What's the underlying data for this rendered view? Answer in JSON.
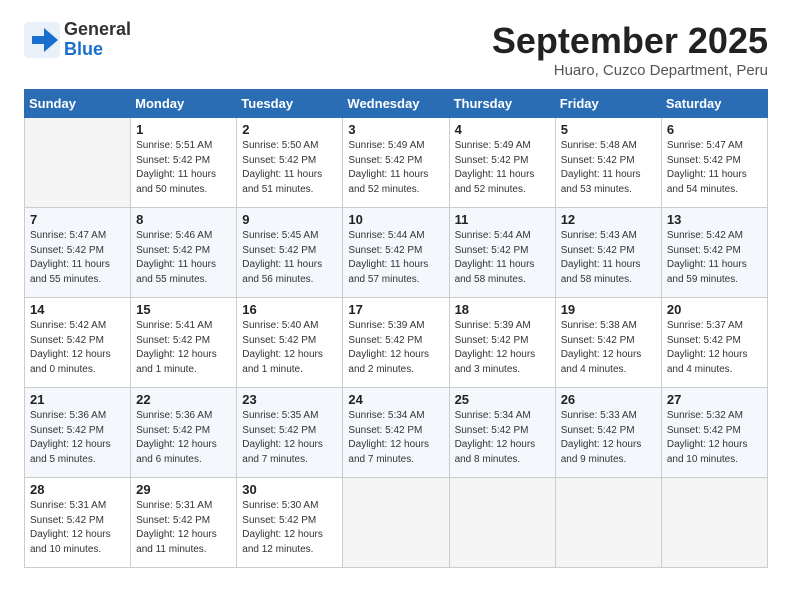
{
  "header": {
    "logo_general": "General",
    "logo_blue": "Blue",
    "month_title": "September 2025",
    "location": "Huaro, Cuzco Department, Peru"
  },
  "days_of_week": [
    "Sunday",
    "Monday",
    "Tuesday",
    "Wednesday",
    "Thursday",
    "Friday",
    "Saturday"
  ],
  "weeks": [
    [
      {
        "day": "",
        "info": ""
      },
      {
        "day": "1",
        "info": "Sunrise: 5:51 AM\nSunset: 5:42 PM\nDaylight: 11 hours\nand 50 minutes."
      },
      {
        "day": "2",
        "info": "Sunrise: 5:50 AM\nSunset: 5:42 PM\nDaylight: 11 hours\nand 51 minutes."
      },
      {
        "day": "3",
        "info": "Sunrise: 5:49 AM\nSunset: 5:42 PM\nDaylight: 11 hours\nand 52 minutes."
      },
      {
        "day": "4",
        "info": "Sunrise: 5:49 AM\nSunset: 5:42 PM\nDaylight: 11 hours\nand 52 minutes."
      },
      {
        "day": "5",
        "info": "Sunrise: 5:48 AM\nSunset: 5:42 PM\nDaylight: 11 hours\nand 53 minutes."
      },
      {
        "day": "6",
        "info": "Sunrise: 5:47 AM\nSunset: 5:42 PM\nDaylight: 11 hours\nand 54 minutes."
      }
    ],
    [
      {
        "day": "7",
        "info": "Sunrise: 5:47 AM\nSunset: 5:42 PM\nDaylight: 11 hours\nand 55 minutes."
      },
      {
        "day": "8",
        "info": "Sunrise: 5:46 AM\nSunset: 5:42 PM\nDaylight: 11 hours\nand 55 minutes."
      },
      {
        "day": "9",
        "info": "Sunrise: 5:45 AM\nSunset: 5:42 PM\nDaylight: 11 hours\nand 56 minutes."
      },
      {
        "day": "10",
        "info": "Sunrise: 5:44 AM\nSunset: 5:42 PM\nDaylight: 11 hours\nand 57 minutes."
      },
      {
        "day": "11",
        "info": "Sunrise: 5:44 AM\nSunset: 5:42 PM\nDaylight: 11 hours\nand 58 minutes."
      },
      {
        "day": "12",
        "info": "Sunrise: 5:43 AM\nSunset: 5:42 PM\nDaylight: 11 hours\nand 58 minutes."
      },
      {
        "day": "13",
        "info": "Sunrise: 5:42 AM\nSunset: 5:42 PM\nDaylight: 11 hours\nand 59 minutes."
      }
    ],
    [
      {
        "day": "14",
        "info": "Sunrise: 5:42 AM\nSunset: 5:42 PM\nDaylight: 12 hours\nand 0 minutes."
      },
      {
        "day": "15",
        "info": "Sunrise: 5:41 AM\nSunset: 5:42 PM\nDaylight: 12 hours\nand 1 minute."
      },
      {
        "day": "16",
        "info": "Sunrise: 5:40 AM\nSunset: 5:42 PM\nDaylight: 12 hours\nand 1 minute."
      },
      {
        "day": "17",
        "info": "Sunrise: 5:39 AM\nSunset: 5:42 PM\nDaylight: 12 hours\nand 2 minutes."
      },
      {
        "day": "18",
        "info": "Sunrise: 5:39 AM\nSunset: 5:42 PM\nDaylight: 12 hours\nand 3 minutes."
      },
      {
        "day": "19",
        "info": "Sunrise: 5:38 AM\nSunset: 5:42 PM\nDaylight: 12 hours\nand 4 minutes."
      },
      {
        "day": "20",
        "info": "Sunrise: 5:37 AM\nSunset: 5:42 PM\nDaylight: 12 hours\nand 4 minutes."
      }
    ],
    [
      {
        "day": "21",
        "info": "Sunrise: 5:36 AM\nSunset: 5:42 PM\nDaylight: 12 hours\nand 5 minutes."
      },
      {
        "day": "22",
        "info": "Sunrise: 5:36 AM\nSunset: 5:42 PM\nDaylight: 12 hours\nand 6 minutes."
      },
      {
        "day": "23",
        "info": "Sunrise: 5:35 AM\nSunset: 5:42 PM\nDaylight: 12 hours\nand 7 minutes."
      },
      {
        "day": "24",
        "info": "Sunrise: 5:34 AM\nSunset: 5:42 PM\nDaylight: 12 hours\nand 7 minutes."
      },
      {
        "day": "25",
        "info": "Sunrise: 5:34 AM\nSunset: 5:42 PM\nDaylight: 12 hours\nand 8 minutes."
      },
      {
        "day": "26",
        "info": "Sunrise: 5:33 AM\nSunset: 5:42 PM\nDaylight: 12 hours\nand 9 minutes."
      },
      {
        "day": "27",
        "info": "Sunrise: 5:32 AM\nSunset: 5:42 PM\nDaylight: 12 hours\nand 10 minutes."
      }
    ],
    [
      {
        "day": "28",
        "info": "Sunrise: 5:31 AM\nSunset: 5:42 PM\nDaylight: 12 hours\nand 10 minutes."
      },
      {
        "day": "29",
        "info": "Sunrise: 5:31 AM\nSunset: 5:42 PM\nDaylight: 12 hours\nand 11 minutes."
      },
      {
        "day": "30",
        "info": "Sunrise: 5:30 AM\nSunset: 5:42 PM\nDaylight: 12 hours\nand 12 minutes."
      },
      {
        "day": "",
        "info": ""
      },
      {
        "day": "",
        "info": ""
      },
      {
        "day": "",
        "info": ""
      },
      {
        "day": "",
        "info": ""
      }
    ]
  ]
}
